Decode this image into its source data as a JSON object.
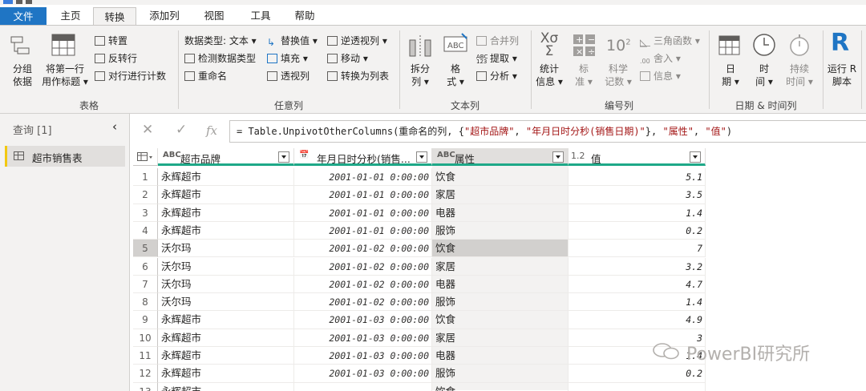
{
  "tabs": [
    "文件",
    "主页",
    "转换",
    "添加列",
    "视图",
    "工具",
    "帮助"
  ],
  "ribbon": {
    "table_group": {
      "label": "表格",
      "group_by": "分组\n依据",
      "first_row_header": "将第一行\n用作标题",
      "transpose": "转置",
      "reverse_rows": "反转行",
      "count_rows": "对行进行计数"
    },
    "any_column_group": {
      "label": "任意列",
      "data_type": "数据类型: 文本",
      "detect_type": "检测数据类型",
      "rename": "重命名",
      "replace_values": "替换值",
      "fill": "填充",
      "pivot": "透视列",
      "unpivot": "逆透视列",
      "move": "移动",
      "to_list": "转换为列表"
    },
    "text_group": {
      "label": "文本列",
      "split": "拆分\n列",
      "format": "格\n式",
      "merge": "合并列",
      "extract": "提取",
      "parse": "分析"
    },
    "number_group": {
      "label": "编号列",
      "stats": "统计\n信息",
      "standard": "标\n准",
      "scientific": "科学\n记数",
      "trig": "三角函数",
      "rounding": "舍入",
      "info": "信息"
    },
    "datetime_group": {
      "label": "日期 & 时间列",
      "date": "日\n期",
      "time": "时\n间",
      "duration": "持续\n时间"
    },
    "scripts_group": {
      "run_r": "运行 R\n脚本"
    }
  },
  "query_pane": {
    "title": "查询 [1]",
    "items": [
      "超市销售表"
    ]
  },
  "formula": {
    "cancel": "✕",
    "confirm": "✓",
    "fx": "fx",
    "text_prefix": "= Table.UnpivotOtherColumns(重命名的列, {",
    "str1": "\"超市品牌\"",
    "sep1": ", ",
    "str2": "\"年月日时分秒(销售日期)\"",
    "sep2": "}, ",
    "str3": "\"属性\"",
    "sep3": ", ",
    "str4": "\"值\"",
    "suffix": ")"
  },
  "grid": {
    "columns": [
      {
        "type": "ABC",
        "name": "超市品牌"
      },
      {
        "type": "📅",
        "name": "年月日时分秒(销售..."
      },
      {
        "type": "ABC",
        "name": "属性"
      },
      {
        "type": "1.2",
        "name": "值"
      }
    ],
    "rows": [
      [
        "1",
        "永辉超市",
        "2001-01-01 0:00:00",
        "饮食",
        "5.1"
      ],
      [
        "2",
        "永辉超市",
        "2001-01-01 0:00:00",
        "家居",
        "3.5"
      ],
      [
        "3",
        "永辉超市",
        "2001-01-01 0:00:00",
        "电器",
        "1.4"
      ],
      [
        "4",
        "永辉超市",
        "2001-01-01 0:00:00",
        "服饰",
        "0.2"
      ],
      [
        "5",
        "沃尔玛",
        "2001-01-02 0:00:00",
        "饮食",
        "7"
      ],
      [
        "6",
        "沃尔玛",
        "2001-01-02 0:00:00",
        "家居",
        "3.2"
      ],
      [
        "7",
        "沃尔玛",
        "2001-01-02 0:00:00",
        "电器",
        "4.7"
      ],
      [
        "8",
        "沃尔玛",
        "2001-01-02 0:00:00",
        "服饰",
        "1.4"
      ],
      [
        "9",
        "永辉超市",
        "2001-01-03 0:00:00",
        "饮食",
        "4.9"
      ],
      [
        "10",
        "永辉超市",
        "2001-01-03 0:00:00",
        "家居",
        "3"
      ],
      [
        "11",
        "永辉超市",
        "2001-01-03 0:00:00",
        "电器",
        "1.4"
      ],
      [
        "12",
        "永辉超市",
        "2001-01-03 0:00:00",
        "服饰",
        "0.2"
      ],
      [
        "13",
        "永辉超市",
        "",
        "饮食",
        ""
      ]
    ],
    "selected_row": 5
  },
  "watermark": "PowerBI研究所",
  "colors": {
    "file_tab": "#1f75c4",
    "accent_bar": "#1ea888",
    "query_marker": "#f2c811"
  }
}
